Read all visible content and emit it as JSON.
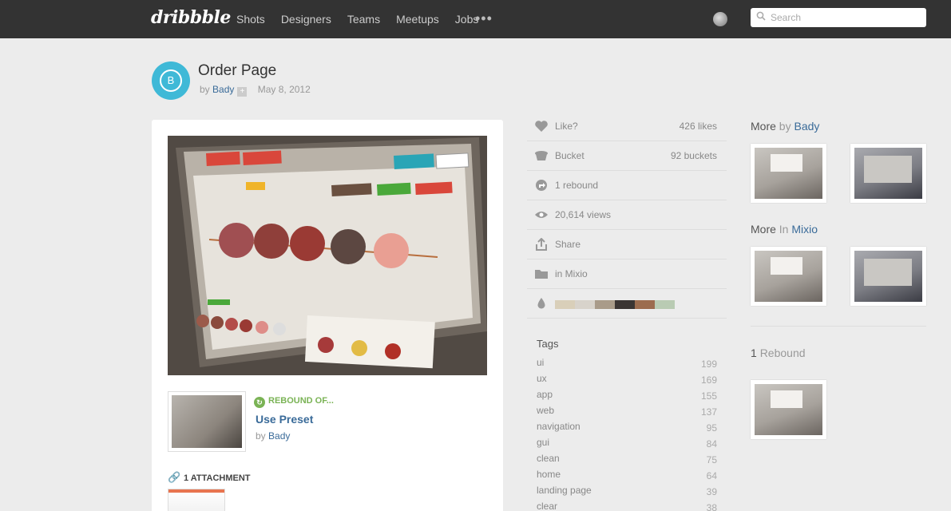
{
  "header": {
    "logo": "dribbble",
    "nav": [
      "Shots",
      "Designers",
      "Teams",
      "Meetups",
      "Jobs"
    ],
    "more": "•••",
    "search_placeholder": "Search"
  },
  "shot": {
    "avatar_letter": "B",
    "title": "Order Page",
    "by": "by",
    "author": "Bady",
    "date": "May 8, 2012"
  },
  "rebound_of": {
    "label": "REBOUND OF...",
    "title": "Use Preset",
    "by": "by",
    "author": "Bady"
  },
  "attachments": {
    "label": "1 ATTACHMENT"
  },
  "stats": {
    "like_label": "Like?",
    "likes": "426 likes",
    "bucket_label": "Bucket",
    "buckets": "92 buckets",
    "rebounds": "1 rebound",
    "views": "20,614 views",
    "share": "Share",
    "project": "in Mixio",
    "palette": [
      "#d9cfb9",
      "#d8d3cb",
      "#a99b89",
      "#3b3533",
      "#9c6c4e",
      "#b9cbb3"
    ]
  },
  "tags": {
    "heading": "Tags",
    "items": [
      {
        "name": "ui",
        "count": "199"
      },
      {
        "name": "ux",
        "count": "169"
      },
      {
        "name": "app",
        "count": "155"
      },
      {
        "name": "web",
        "count": "137"
      },
      {
        "name": "navigation",
        "count": "95"
      },
      {
        "name": "gui",
        "count": "84"
      },
      {
        "name": "clean",
        "count": "75"
      },
      {
        "name": "home",
        "count": "64"
      },
      {
        "name": "landing page",
        "count": "39"
      },
      {
        "name": "clear",
        "count": "38"
      }
    ]
  },
  "sidebar": {
    "more_by": "More",
    "more_by_mid": "by",
    "more_by_author": "Bady",
    "more_in": "More",
    "more_in_mid": "In",
    "more_in_project": "Mixio",
    "rebound_count": "1",
    "rebound_word": "Rebound"
  },
  "colors": {
    "accent_blue": "#3a6b99",
    "rebound_green": "#7ab355",
    "avatar_teal": "#3fb9d7"
  }
}
